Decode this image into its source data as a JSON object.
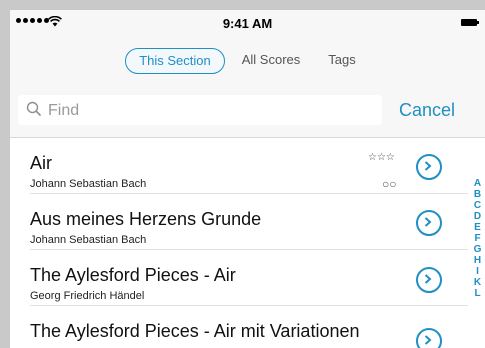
{
  "status_bar": {
    "time": "9:41 AM"
  },
  "tabs": [
    {
      "label": "This Section",
      "active": true
    },
    {
      "label": "All Scores",
      "active": false
    },
    {
      "label": "Tags",
      "active": false
    }
  ],
  "search": {
    "placeholder": "Find",
    "value": "",
    "cancel_label": "Cancel"
  },
  "scores": [
    {
      "title": "Air",
      "composer": "Johann Sebastian Bach",
      "rating_stars": "☆☆☆",
      "status_circles": "○○"
    },
    {
      "title": "Aus meines Herzens Grunde",
      "composer": "Johann Sebastian Bach"
    },
    {
      "title": "The Aylesford Pieces - Air",
      "composer": "Georg Friedrich Händel"
    },
    {
      "title": "The Aylesford Pieces - Air mit Variationen",
      "composer": ""
    }
  ],
  "index_letters": [
    "A",
    "B",
    "C",
    "D",
    "E",
    "F",
    "G",
    "H",
    "I",
    "K",
    "L"
  ],
  "colors": {
    "accent": "#1f8fc4",
    "background": "#f7f7f7",
    "outer": "#c9c9c9"
  }
}
